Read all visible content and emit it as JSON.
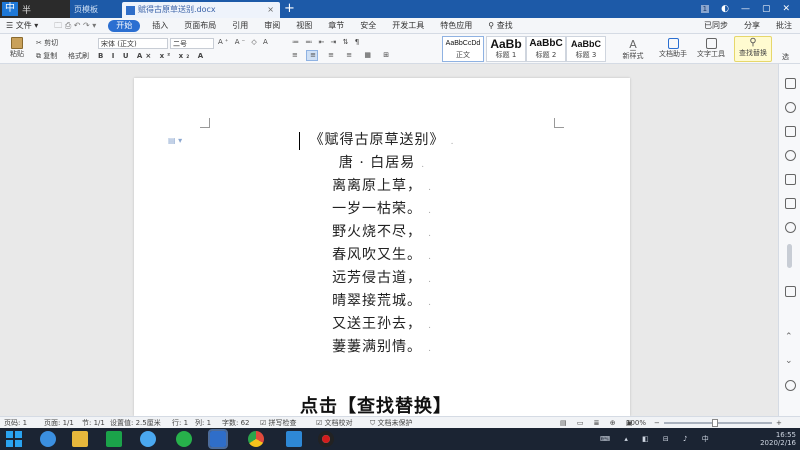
{
  "titlebar": {
    "ime": {
      "char1": "中",
      "char2": "半"
    },
    "tab_template": "页模板",
    "tab_document": "赋得古原草送别.docx",
    "tab_close": "×",
    "new_tab": "+",
    "badge": "1"
  },
  "menubar": {
    "file": "文件",
    "items": [
      "开始",
      "插入",
      "页面布局",
      "引用",
      "审阅",
      "视图",
      "章节",
      "安全",
      "开发工具",
      "特色应用"
    ],
    "search": "查找",
    "right": {
      "sync": "已同步",
      "share": "分享",
      "comment": "批注"
    }
  },
  "ribbon": {
    "paste": "粘贴",
    "cut": "剪切",
    "copy": "复制",
    "format_painter": "格式刷",
    "font_name": "宋体 (正文)",
    "font_size": "二号",
    "styles": [
      {
        "sample": "AaBbCcDd",
        "label": "正文"
      },
      {
        "sample": "AaBb",
        "label": "标题 1"
      },
      {
        "sample": "AaBbC",
        "label": "标题 2"
      },
      {
        "sample": "AaBbC",
        "label": "标题 3"
      }
    ],
    "new_style": "新样式",
    "doc_helper": "文档助手",
    "text_tools": "文字工具",
    "find_replace": "查找替换",
    "select": "选"
  },
  "document": {
    "lines": [
      "《赋得古原草送别》",
      "唐 · 白居易",
      "离离原上草，",
      "一岁一枯荣。",
      "野火烧不尽，",
      "春风吹又生。",
      "远芳侵古道，",
      "晴翠接荒城。",
      "又送王孙去，",
      "萋萋满别情。"
    ]
  },
  "caption": "点击【查找替换】",
  "statusbar": {
    "page_num": "页码: 1",
    "page": "页面: 1/1",
    "section": "节: 1/1",
    "setting": "设置值: 2.5厘米",
    "row": "行: 1",
    "col": "列: 1",
    "chars": "字数: 62",
    "spell": "拼写检查",
    "proof": "文档校对",
    "unprotected": "文档未保护",
    "zoom": "100%"
  },
  "taskbar": {
    "time": "16:55",
    "date": "2020/2/16"
  },
  "colors": {
    "titlebar": "#1d5aa8",
    "accent": "#2b6fd1",
    "taskbar": "#1b2433"
  }
}
